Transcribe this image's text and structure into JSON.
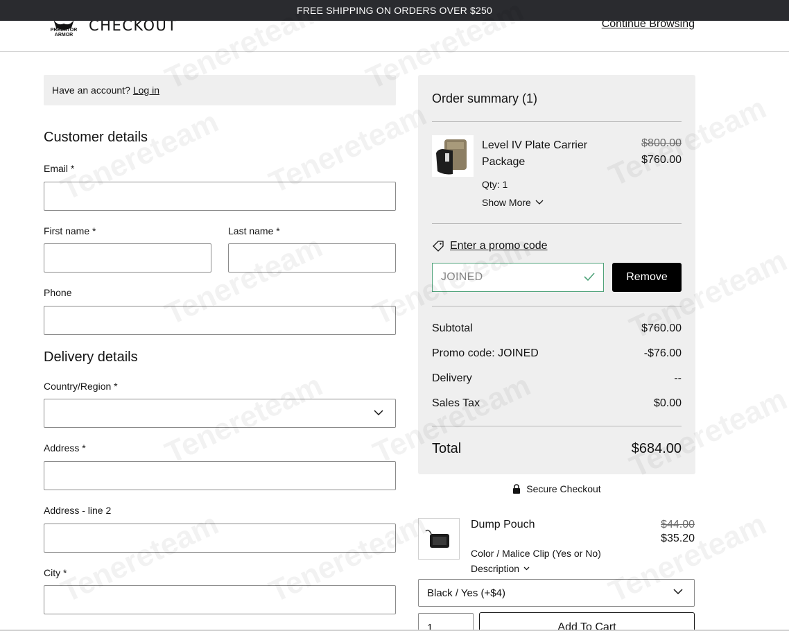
{
  "announcement": "FREE SHIPPING ON ORDERS OVER $250",
  "header": {
    "logo_text_1": "PREDATOR",
    "logo_text_2": "ARMOR",
    "title": "CHECKOUT",
    "continue_link": "Continue Browsing"
  },
  "login": {
    "prompt": "Have an account?",
    "link": "Log in"
  },
  "customer": {
    "title": "Customer details",
    "email_label": "Email *",
    "first_name_label": "First name *",
    "last_name_label": "Last name *",
    "phone_label": "Phone"
  },
  "delivery": {
    "title": "Delivery details",
    "country_label": "Country/Region *",
    "address_label": "Address *",
    "address2_label": "Address - line 2",
    "city_label": "City *"
  },
  "summary": {
    "title": "Order summary (1)",
    "item": {
      "name": "Level IV Plate Carrier Package",
      "price_old": "$800.00",
      "price_new": "$760.00",
      "qty": "Qty: 1",
      "show_more": "Show More"
    },
    "promo_link": "Enter a promo code",
    "promo_value": "JOINED",
    "remove_label": "Remove",
    "rows": {
      "subtotal_label": "Subtotal",
      "subtotal_value": "$760.00",
      "promo_label": "Promo code: JOINED",
      "promo_value": "-$76.00",
      "delivery_label": "Delivery",
      "delivery_value": "--",
      "tax_label": "Sales Tax",
      "tax_value": "$0.00"
    },
    "total_label": "Total",
    "total_value": "$684.00"
  },
  "secure": "Secure Checkout",
  "upsell": {
    "name": "Dump Pouch",
    "price_old": "$44.00",
    "price_new": "$35.20",
    "option_label": "Color / Malice Clip (Yes or No)",
    "description": "Description",
    "selected_option": "Black / Yes (+$4)",
    "qty": "1",
    "add_to_cart": "Add To Cart"
  },
  "watermark": "Tenereteam",
  "colors": {
    "announce_bg": "#2a2b2f",
    "summary_bg": "#efefef",
    "promo_border": "#4fa37a",
    "button_bg": "#000000"
  },
  "icons": [
    "logo-icon",
    "chevron-down-icon",
    "tag-icon",
    "check-icon",
    "lock-icon"
  ]
}
